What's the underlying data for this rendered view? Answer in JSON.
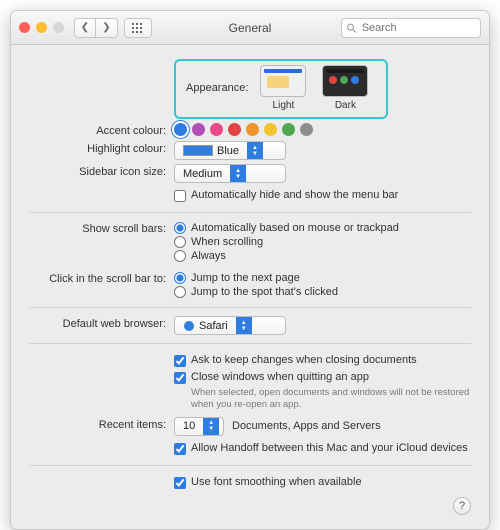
{
  "title": "General",
  "search": {
    "placeholder": "Search"
  },
  "appearance": {
    "label": "Appearance:",
    "light": "Light",
    "dark": "Dark"
  },
  "accent": {
    "label": "Accent colour:",
    "colors": [
      "#2f7de1",
      "#b14fb8",
      "#e84a8a",
      "#e24343",
      "#f0952e",
      "#f4c430",
      "#4fa84f",
      "#8e8e8e"
    ],
    "selected": 0
  },
  "highlight": {
    "label": "Highlight colour:",
    "value": "Blue"
  },
  "sidebar_icon": {
    "label": "Sidebar icon size:",
    "value": "Medium"
  },
  "auto_hide_menu": {
    "label": "Automatically hide and show the menu bar",
    "checked": false
  },
  "scrollbars": {
    "label": "Show scroll bars:",
    "options": [
      "Automatically based on mouse or trackpad",
      "When scrolling",
      "Always"
    ],
    "selected": 0
  },
  "click_scroll": {
    "label": "Click in the scroll bar to:",
    "options": [
      "Jump to the next page",
      "Jump to the spot that's clicked"
    ],
    "selected": 0
  },
  "browser": {
    "label": "Default web browser:",
    "value": "Safari"
  },
  "ask_keep": {
    "label": "Ask to keep changes when closing documents",
    "checked": true
  },
  "close_windows": {
    "label": "Close windows when quitting an app",
    "checked": true,
    "fine": "When selected, open documents and windows will not be restored when you re-open an app."
  },
  "recent": {
    "label": "Recent items:",
    "value": "10",
    "suffix": "Documents, Apps and Servers"
  },
  "handoff": {
    "label": "Allow Handoff between this Mac and your iCloud devices",
    "checked": true
  },
  "smoothing": {
    "label": "Use font smoothing when available",
    "checked": true
  }
}
